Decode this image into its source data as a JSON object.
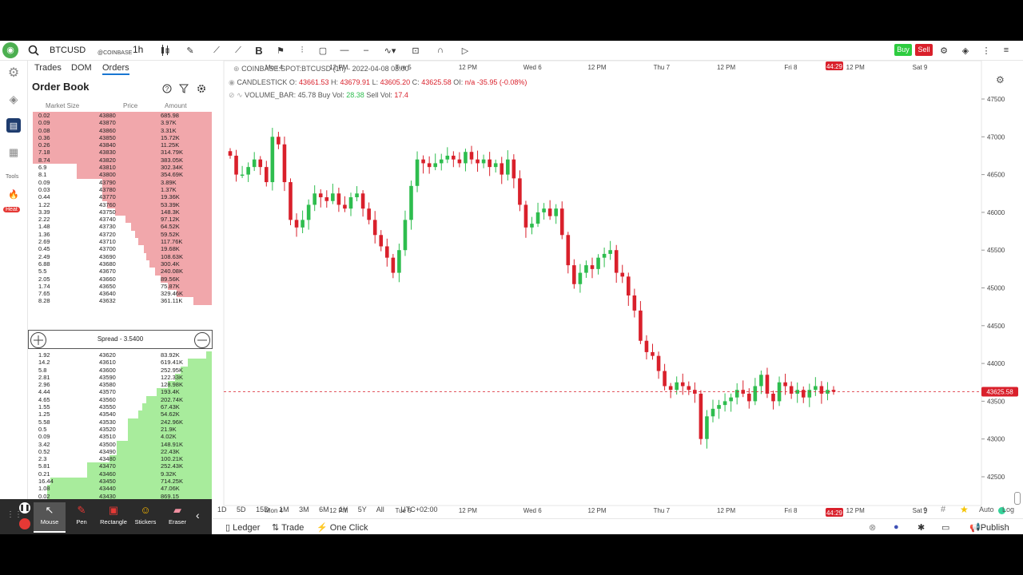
{
  "toolbar": {
    "symbol": "BTCUSD",
    "exchange": "@COINBASE",
    "timeframe": "1h",
    "buy_label": "Buy",
    "sell_label": "Sell"
  },
  "sidebar": {
    "tools_label": "Tools",
    "heat_label": "Heat"
  },
  "panel": {
    "tabs": [
      "Trades",
      "DOM",
      "Orders"
    ],
    "title": "Order Book",
    "columns": [
      "Market Size",
      "Price",
      "Amount"
    ],
    "spread_label": "Spread - 3.5400",
    "asks": [
      [
        "0.02",
        "43880",
        "685.98"
      ],
      [
        "0.09",
        "43870",
        "3.97K"
      ],
      [
        "0.08",
        "43860",
        "3.31K"
      ],
      [
        "0.36",
        "43850",
        "15.72K"
      ],
      [
        "0.26",
        "43840",
        "11.25K"
      ],
      [
        "7.18",
        "43830",
        "314.79K"
      ],
      [
        "8.74",
        "43820",
        "383.05K"
      ],
      [
        "6.9",
        "43810",
        "302.34K"
      ],
      [
        "8.1",
        "43800",
        "354.69K"
      ],
      [
        "0.09",
        "43790",
        "3.89K"
      ],
      [
        "0.03",
        "43780",
        "1.37K"
      ],
      [
        "0.44",
        "43770",
        "19.36K"
      ],
      [
        "1.22",
        "43760",
        "53.39K"
      ],
      [
        "3.39",
        "43750",
        "148.3K"
      ],
      [
        "2.22",
        "43740",
        "97.12K"
      ],
      [
        "1.48",
        "43730",
        "64.52K"
      ],
      [
        "1.36",
        "43720",
        "59.52K"
      ],
      [
        "2.69",
        "43710",
        "117.76K"
      ],
      [
        "0.45",
        "43700",
        "19.68K"
      ],
      [
        "2.49",
        "43690",
        "108.63K"
      ],
      [
        "6.88",
        "43680",
        "300.4K"
      ],
      [
        "5.5",
        "43670",
        "240.08K"
      ],
      [
        "2.05",
        "43660",
        "89.56K"
      ],
      [
        "1.74",
        "43650",
        "75.87K"
      ],
      [
        "7.65",
        "43640",
        "329.46K"
      ],
      [
        "8.28",
        "43632",
        "361.11K"
      ]
    ],
    "ask_depth": [
      0.98,
      0.98,
      0.98,
      0.98,
      0.98,
      0.98,
      0.98,
      0.74,
      0.74,
      0.6,
      0.6,
      0.6,
      0.57,
      0.53,
      0.47,
      0.44,
      0.42,
      0.4,
      0.37,
      0.36,
      0.34,
      0.31,
      0.28,
      0.24,
      0.19,
      0.1
    ],
    "bids": [
      [
        "1.92",
        "43620",
        "83.92K"
      ],
      [
        "14.2",
        "43610",
        "619.41K"
      ],
      [
        "5.8",
        "43600",
        "252.95K"
      ],
      [
        "2.81",
        "43590",
        "122.33K"
      ],
      [
        "2.96",
        "43580",
        "128.98K"
      ],
      [
        "4.44",
        "43570",
        "193.4K"
      ],
      [
        "4.65",
        "43560",
        "202.74K"
      ],
      [
        "1.55",
        "43550",
        "67.43K"
      ],
      [
        "1.25",
        "43540",
        "54.62K"
      ],
      [
        "5.58",
        "43530",
        "242.96K"
      ],
      [
        "0.5",
        "43520",
        "21.9K"
      ],
      [
        "0.09",
        "43510",
        "4.02K"
      ],
      [
        "3.42",
        "43500",
        "148.91K"
      ],
      [
        "0.52",
        "43490",
        "22.43K"
      ],
      [
        "2.3",
        "43480",
        "100.21K"
      ],
      [
        "5.81",
        "43470",
        "252.43K"
      ],
      [
        "0.21",
        "43460",
        "9.32K"
      ],
      [
        "16.44",
        "43450",
        "714.25K"
      ],
      [
        "1.08",
        "43440",
        "47.06K"
      ],
      [
        "0.02",
        "43430",
        "869.15"
      ],
      [
        "0.1",
        "43420",
        "4.47K"
      ],
      [
        "1.65",
        "43410",
        "71.74K"
      ]
    ],
    "bid_depth": [
      0.03,
      0.13,
      0.17,
      0.2,
      0.24,
      0.3,
      0.36,
      0.38,
      0.4,
      0.46,
      0.46,
      0.46,
      0.52,
      0.52,
      0.56,
      0.68,
      0.68,
      0.88,
      0.9,
      0.9,
      0.9,
      0.95
    ]
  },
  "drawing_tools": [
    "Mouse",
    "Pen",
    "Rectangle",
    "Stickers",
    "Eraser"
  ],
  "chart": {
    "title": "COINBASE:SPOT:BTCUSD (1h) - 2022-04-08 08:00",
    "ohlc_label": "CANDLESTICK",
    "o_label": "O:",
    "o": "43661.53",
    "h_label": "H:",
    "h": "43679.91",
    "l_label": "L:",
    "l": "43605.20",
    "c_label": "C:",
    "c": "43625.58",
    "oi_label": "OI:",
    "oi": "n/a",
    "change": "-35.95",
    "change_pct": "(-0.08%)",
    "volume_label": "VOLUME_BAR:",
    "volume": "45.78",
    "buy_vol_label": "Buy Vol:",
    "buy_vol": "28.38",
    "sell_vol_label": "Sell Vol:",
    "sell_vol": "17.4",
    "current_price": "43625.58",
    "time_badge": "44:29",
    "timezone": "UTC+02:00",
    "auto_label": "Auto",
    "log_label": "Log",
    "up_color": "#2ebd4e",
    "down_color": "#d9202b"
  },
  "chart_data": {
    "type": "candlestick",
    "y_ticks": [
      "47500",
      "47000",
      "46500",
      "46000",
      "45500",
      "45000",
      "44500",
      "44000",
      "43500",
      "43000",
      "42500"
    ],
    "ylim": [
      42500,
      47500
    ],
    "x_ticks": [
      "Mon 4",
      "12 PM",
      "Tue 5",
      "12 PM",
      "Wed 6",
      "12 PM",
      "Thu 7",
      "12 PM",
      "Fri 8",
      "12 PM",
      "Sat 9"
    ],
    "close_series": [
      46750,
      46500,
      46500,
      46600,
      46700,
      46600,
      46400,
      47000,
      46900,
      46400,
      45900,
      45800,
      45900,
      46100,
      46250,
      46200,
      46150,
      46250,
      46100,
      46050,
      46200,
      46250,
      46050,
      45900,
      45700,
      45550,
      45400,
      45200,
      45500,
      45900,
      46350,
      46700,
      46650,
      46600,
      46650,
      46700,
      46750,
      46700,
      46650,
      46800,
      46700,
      46650,
      46700,
      46600,
      46650,
      46500,
      46700,
      46450,
      46100,
      45800,
      45850,
      46000,
      46050,
      45950,
      46050,
      45700,
      45300,
      45050,
      45200,
      45300,
      45250,
      45400,
      45450,
      45500,
      45200,
      45150,
      44900,
      44700,
      44300,
      44150,
      44100,
      43900,
      43700,
      43650,
      43750,
      43700,
      43650,
      43600,
      43000,
      43300,
      43400,
      43450,
      43500,
      43550,
      43650,
      43600,
      43500,
      43700,
      43850,
      43600,
      43500,
      43750,
      43700,
      43600,
      43650,
      43550,
      43650,
      43700,
      43600,
      43650,
      43625.58
    ]
  },
  "bottom_bar": {
    "ranges": [
      "1D",
      "5D",
      "15D",
      "1M",
      "3M",
      "6M",
      "1Y",
      "5Y",
      "All"
    ],
    "ledger": "Ledger",
    "trade": "Trade",
    "one_click": "One Click",
    "publish": "Publish"
  }
}
